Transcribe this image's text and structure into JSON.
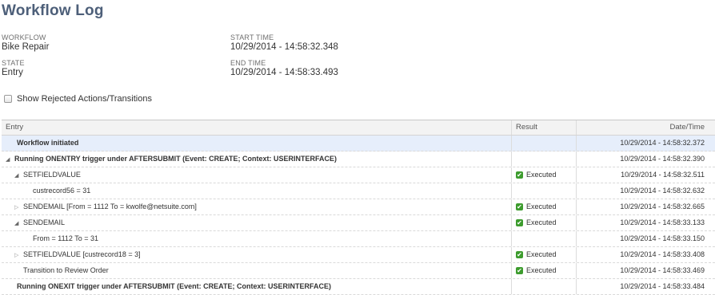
{
  "page": {
    "title": "Workflow Log"
  },
  "fields": {
    "workflow": {
      "label": "WORKFLOW",
      "value": "Bike Repair"
    },
    "state": {
      "label": "STATE",
      "value": "Entry"
    },
    "start_time": {
      "label": "START TIME",
      "value": "10/29/2014 - 14:58:32.348"
    },
    "end_time": {
      "label": "END TIME",
      "value": "10/29/2014 - 14:58:33.493"
    }
  },
  "options": {
    "show_rejected_label": "Show Rejected Actions/Transitions",
    "show_rejected_checked": false
  },
  "table": {
    "columns": {
      "entry": "Entry",
      "result": "Result",
      "date": "Date/Time"
    },
    "rows": [
      {
        "entry": "Workflow initiated",
        "result": "",
        "date": "10/29/2014 - 14:58:32.372",
        "level": 0,
        "bold": true,
        "toggle": "none",
        "highlight": true
      },
      {
        "entry": "Running ONENTRY trigger under AFTERSUBMIT (Event: CREATE; Context: USERINTERFACE)",
        "result": "",
        "date": "10/29/2014 - 14:58:32.390",
        "level": 0,
        "bold": true,
        "toggle": "expanded"
      },
      {
        "entry": "SETFIELDVALUE",
        "result": "Executed",
        "date": "10/29/2014 - 14:58:32.511",
        "level": 1,
        "bold": false,
        "toggle": "expanded"
      },
      {
        "entry": "custrecord56 = 31",
        "result": "",
        "date": "10/29/2014 - 14:58:32.632",
        "level": 2,
        "bold": false,
        "toggle": "none"
      },
      {
        "entry": "SENDEMAIL [From = 1112 To = kwolfe@netsuite.com]",
        "result": "Executed",
        "date": "10/29/2014 - 14:58:32.665",
        "level": 1,
        "bold": false,
        "toggle": "collapsed"
      },
      {
        "entry": "SENDEMAIL",
        "result": "Executed",
        "date": "10/29/2014 - 14:58:33.133",
        "level": 1,
        "bold": false,
        "toggle": "expanded"
      },
      {
        "entry": "From = 1112 To = 31",
        "result": "",
        "date": "10/29/2014 - 14:58:33.150",
        "level": 2,
        "bold": false,
        "toggle": "none"
      },
      {
        "entry": "SETFIELDVALUE [custrecord18 = 3]",
        "result": "Executed",
        "date": "10/29/2014 - 14:58:33.408",
        "level": 1,
        "bold": false,
        "toggle": "collapsed"
      },
      {
        "entry": "Transition to Review Order",
        "result": "Executed",
        "date": "10/29/2014 - 14:58:33.469",
        "level": 1,
        "bold": false,
        "toggle": "none"
      },
      {
        "entry": "Running ONEXIT trigger under AFTERSUBMIT (Event: CREATE; Context: USERINTERFACE)",
        "result": "",
        "date": "10/29/2014 - 14:58:33.484",
        "level": 0,
        "bold": true,
        "toggle": "none"
      }
    ]
  },
  "icons": {
    "toggle_expanded": "triangle-down-icon",
    "toggle_collapsed": "triangle-right-icon",
    "result_ok": "green-check-icon"
  },
  "colors": {
    "title": "#4d5f79",
    "highlight_row": "#e6eefb",
    "executed_check": "#3d9c2e"
  }
}
